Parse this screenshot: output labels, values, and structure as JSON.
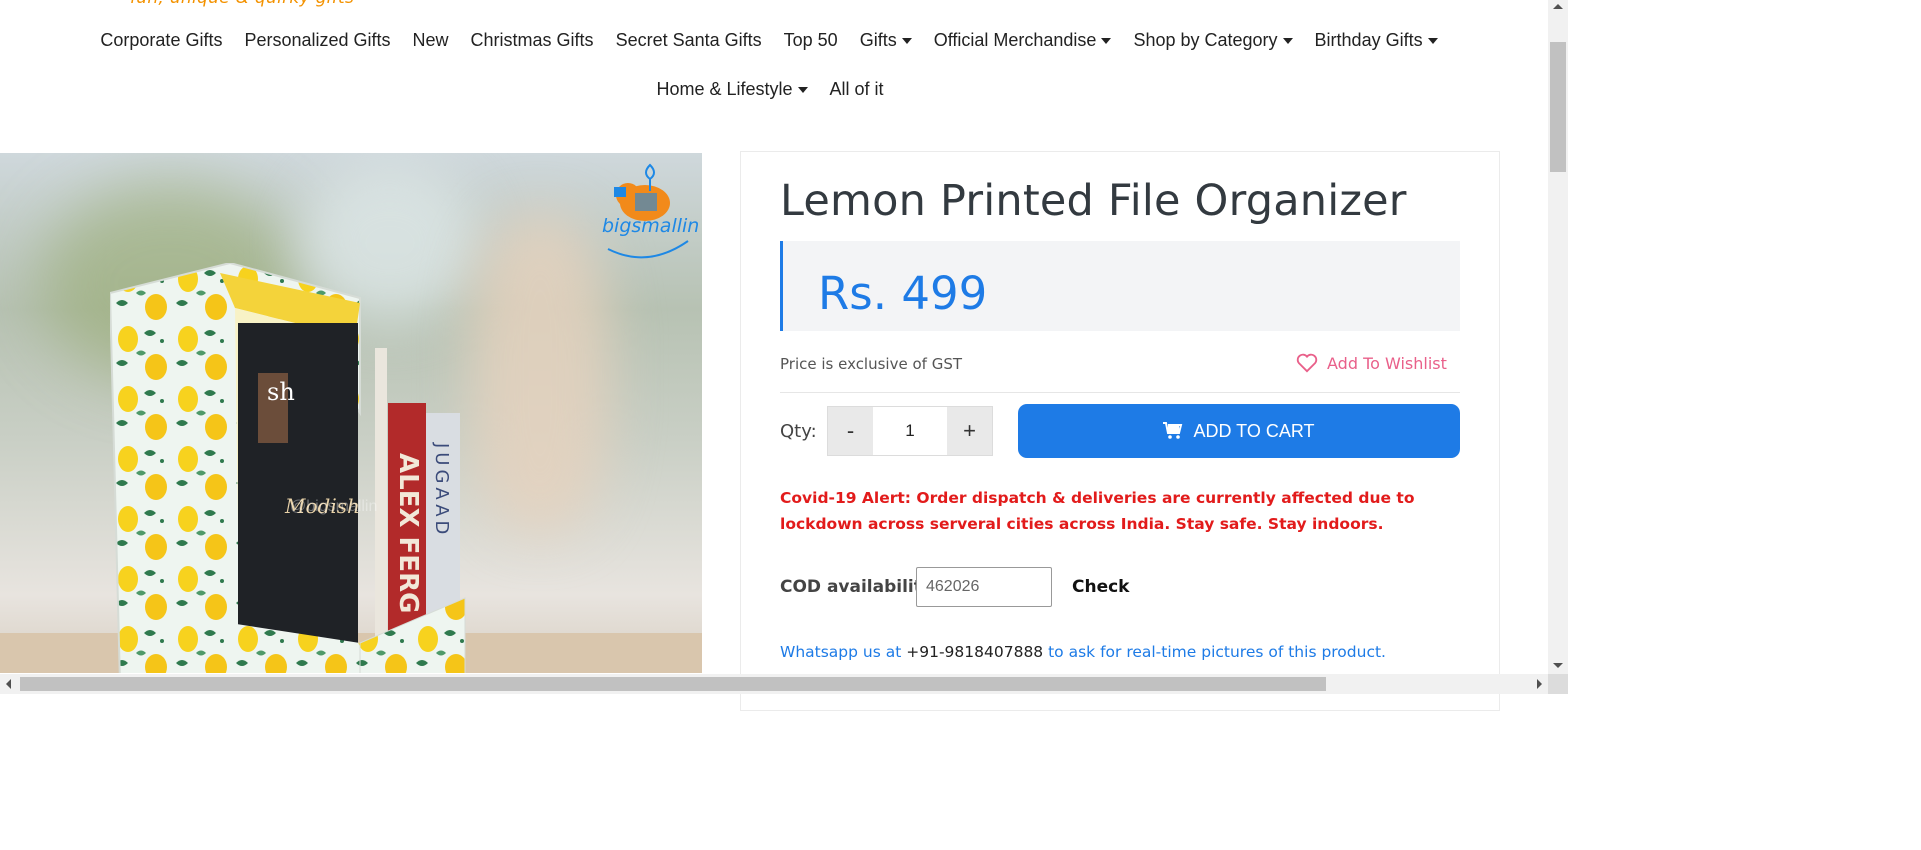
{
  "header": {
    "tagline": "fun, unique & quirky gifts"
  },
  "nav": {
    "row1": [
      {
        "label": "Corporate Gifts",
        "has_dropdown": false
      },
      {
        "label": "Personalized Gifts",
        "has_dropdown": false
      },
      {
        "label": "New",
        "has_dropdown": false
      },
      {
        "label": "Christmas Gifts",
        "has_dropdown": false
      },
      {
        "label": "Secret Santa Gifts",
        "has_dropdown": false
      },
      {
        "label": "Top 50",
        "has_dropdown": false
      },
      {
        "label": "Gifts",
        "has_dropdown": true
      },
      {
        "label": "Official Merchandise",
        "has_dropdown": true
      },
      {
        "label": "Shop by Category",
        "has_dropdown": true
      },
      {
        "label": "Birthday Gifts",
        "has_dropdown": true
      }
    ],
    "row2": [
      {
        "label": "Home & Lifestyle",
        "has_dropdown": true
      },
      {
        "label": "All of it",
        "has_dropdown": false
      }
    ]
  },
  "product_image": {
    "brand_logo_text": "bigsmallin",
    "watermark": "@bigsmallin",
    "books": [
      "sh",
      "Modish",
      "ALEX FERG",
      "JUGAAD"
    ]
  },
  "product": {
    "title": "Lemon Printed File Organizer",
    "price": "Rs. 499",
    "gst_note": "Price is exclusive of GST",
    "wishlist_label": "Add To Wishlist",
    "qty_label": "Qty:",
    "qty_minus": "-",
    "qty_plus": "+",
    "qty_value": "1",
    "add_to_cart_label": "ADD TO CART",
    "covid_alert": "Covid-19 Alert: Order dispatch & deliveries are currently affected due to lockdown across serveral cities across India. Stay safe. Stay indoors.",
    "cod_label": "COD availability",
    "cod_pincode": "462026",
    "check_label": "Check",
    "whatsapp_prefix": "Whatsapp us at",
    "whatsapp_phone": "+91-9818407888",
    "whatsapp_suffix": "to ask for real-time pictures of this product."
  },
  "colors": {
    "accent": "#1e7be6",
    "alert": "#e21b1b",
    "wishlist": "#e9608a",
    "tagline": "#f39200"
  }
}
